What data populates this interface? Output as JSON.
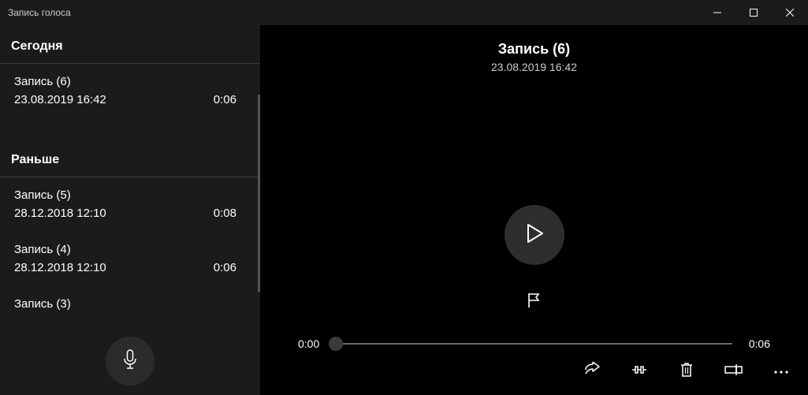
{
  "window": {
    "title": "Запись голоса"
  },
  "sidebar": {
    "sections": [
      {
        "header": "Сегодня",
        "items": [
          {
            "title": "Запись (6)",
            "date": "23.08.2019 16:42",
            "duration": "0:06"
          }
        ]
      },
      {
        "header": "Раньше",
        "items": [
          {
            "title": "Запись (5)",
            "date": "28.12.2018 12:10",
            "duration": "0:08"
          },
          {
            "title": "Запись (4)",
            "date": "28.12.2018 12:10",
            "duration": "0:06"
          },
          {
            "title": "Запись (3)",
            "date": "",
            "duration": ""
          }
        ]
      }
    ]
  },
  "main": {
    "title": "Запись (6)",
    "date": "23.08.2019 16:42",
    "current_time": "0:00",
    "total_time": "0:06"
  }
}
